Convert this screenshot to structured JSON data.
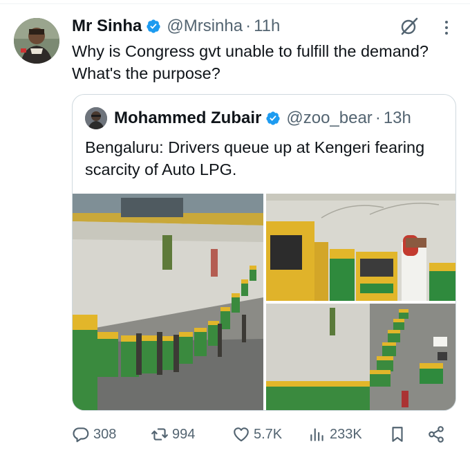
{
  "tweet": {
    "author_name": "Mr Sinha",
    "author_handle": "@Mrsinha",
    "separator": "·",
    "time": "11h",
    "text": "Why is Congress gvt unable to fulfill the demand? What's the purpose?"
  },
  "quote": {
    "author_name": "Mohammed Zubair",
    "author_handle": "@zoo_bear",
    "separator": "·",
    "time": "13h",
    "text": "Bengaluru: Drivers queue up at Kengeri fearing scarcity of Auto LPG."
  },
  "metrics": {
    "replies": "308",
    "retweets": "994",
    "likes": "5.7K",
    "views": "233K"
  },
  "icons": {
    "verified": "verified-badge-icon",
    "grok": "grok-icon",
    "more": "more-dots-icon",
    "reply": "reply-bubble-icon",
    "retweet": "retweet-icon",
    "like": "heart-icon",
    "views": "views-bars-icon",
    "bookmark": "bookmark-icon",
    "share": "share-icon"
  },
  "colors": {
    "text_primary": "#0f1419",
    "text_secondary": "#536471",
    "verified_blue": "#1d9bf0",
    "border": "#cfd9de"
  }
}
